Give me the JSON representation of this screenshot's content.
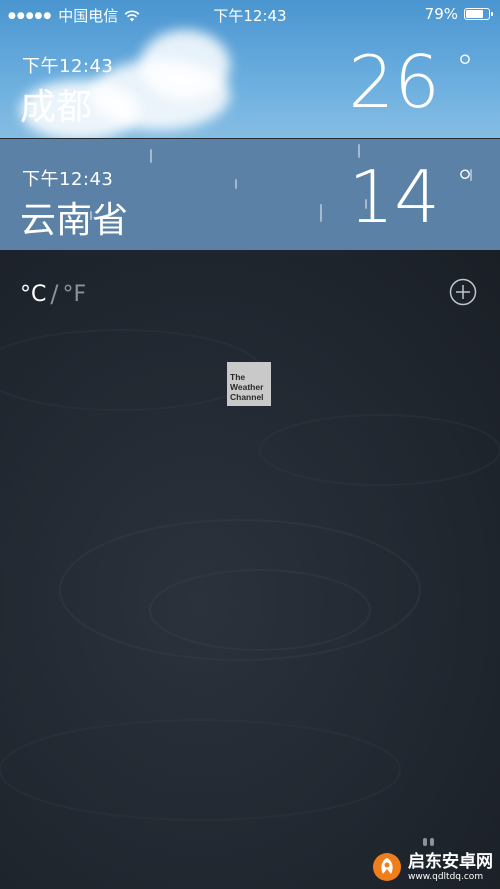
{
  "status_bar": {
    "signal": "●●●●●",
    "carrier": "中国电信",
    "time": "下午12:43",
    "battery_text": "79%",
    "battery_level": 0.79
  },
  "cities": [
    {
      "time": "下午12:43",
      "name": "成都",
      "temp": "26",
      "degree": "°"
    },
    {
      "time": "下午12:43",
      "name": "云南省",
      "temp": "14",
      "degree": "°"
    }
  ],
  "units": {
    "celsius": "°C",
    "separator": "/",
    "fahrenheit": "°F"
  },
  "logo": {
    "line1": "The",
    "line2": "Weather",
    "line3": "Channel"
  },
  "watermark": {
    "title": "启东安卓网",
    "url": "www.qdltdq.com"
  },
  "colors": {
    "sunny_sky": "#4a95d0",
    "rain_row": "#5b82a6",
    "water": "#222830"
  }
}
